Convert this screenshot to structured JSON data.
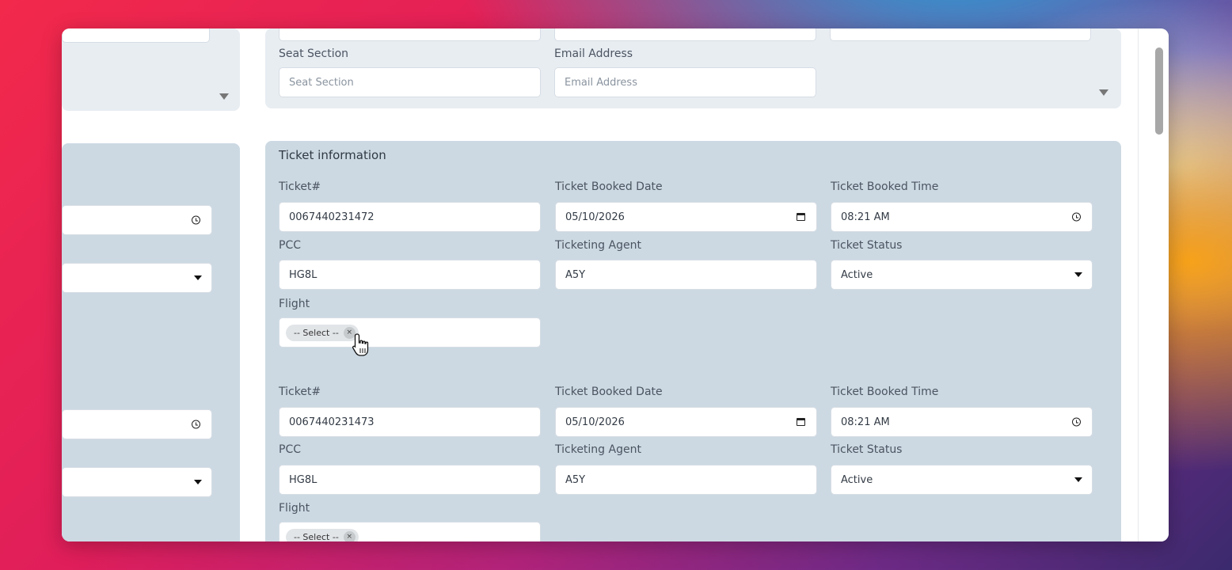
{
  "contact": {
    "seat_section_label": "Seat Section",
    "seat_section_placeholder": "Seat Section",
    "email_label": "Email Address",
    "email_placeholder": "Email Address"
  },
  "ticket_section": {
    "title": "Ticket information",
    "tickets": [
      {
        "ticket_label": "Ticket#",
        "ticket_value": "0067440231472",
        "booked_date_label": "Ticket Booked Date",
        "booked_date_value": "05/10/2026",
        "booked_time_label": "Ticket Booked Time",
        "booked_time_value": "08:21 AM",
        "pcc_label": "PCC",
        "pcc_value": "HG8L",
        "agent_label": "Ticketing Agent",
        "agent_value": "A5Y",
        "status_label": "Ticket Status",
        "status_value": "Active",
        "flight_label": "Flight",
        "flight_chip": "-- Select --"
      },
      {
        "ticket_label": "Ticket#",
        "ticket_value": "0067440231473",
        "booked_date_label": "Ticket Booked Date",
        "booked_date_value": "05/10/2026",
        "booked_time_label": "Ticket Booked Time",
        "booked_time_value": "08:21 AM",
        "pcc_label": "PCC",
        "pcc_value": "HG8L",
        "agent_label": "Ticketing Agent",
        "agent_value": "A5Y",
        "status_label": "Ticket Status",
        "status_value": "Active",
        "flight_label": "Flight",
        "flight_chip": "-- Select --"
      }
    ]
  },
  "icons": {
    "clock": "clock-icon",
    "calendar": "calendar-icon",
    "dropdown": "chevron-down-icon",
    "clear": "close-icon",
    "cursor": "hand-pointer-icon"
  },
  "colors": {
    "panel_light": "#e8edf2",
    "panel_dark": "#ccd9e3",
    "field_bg": "#ffffff"
  }
}
